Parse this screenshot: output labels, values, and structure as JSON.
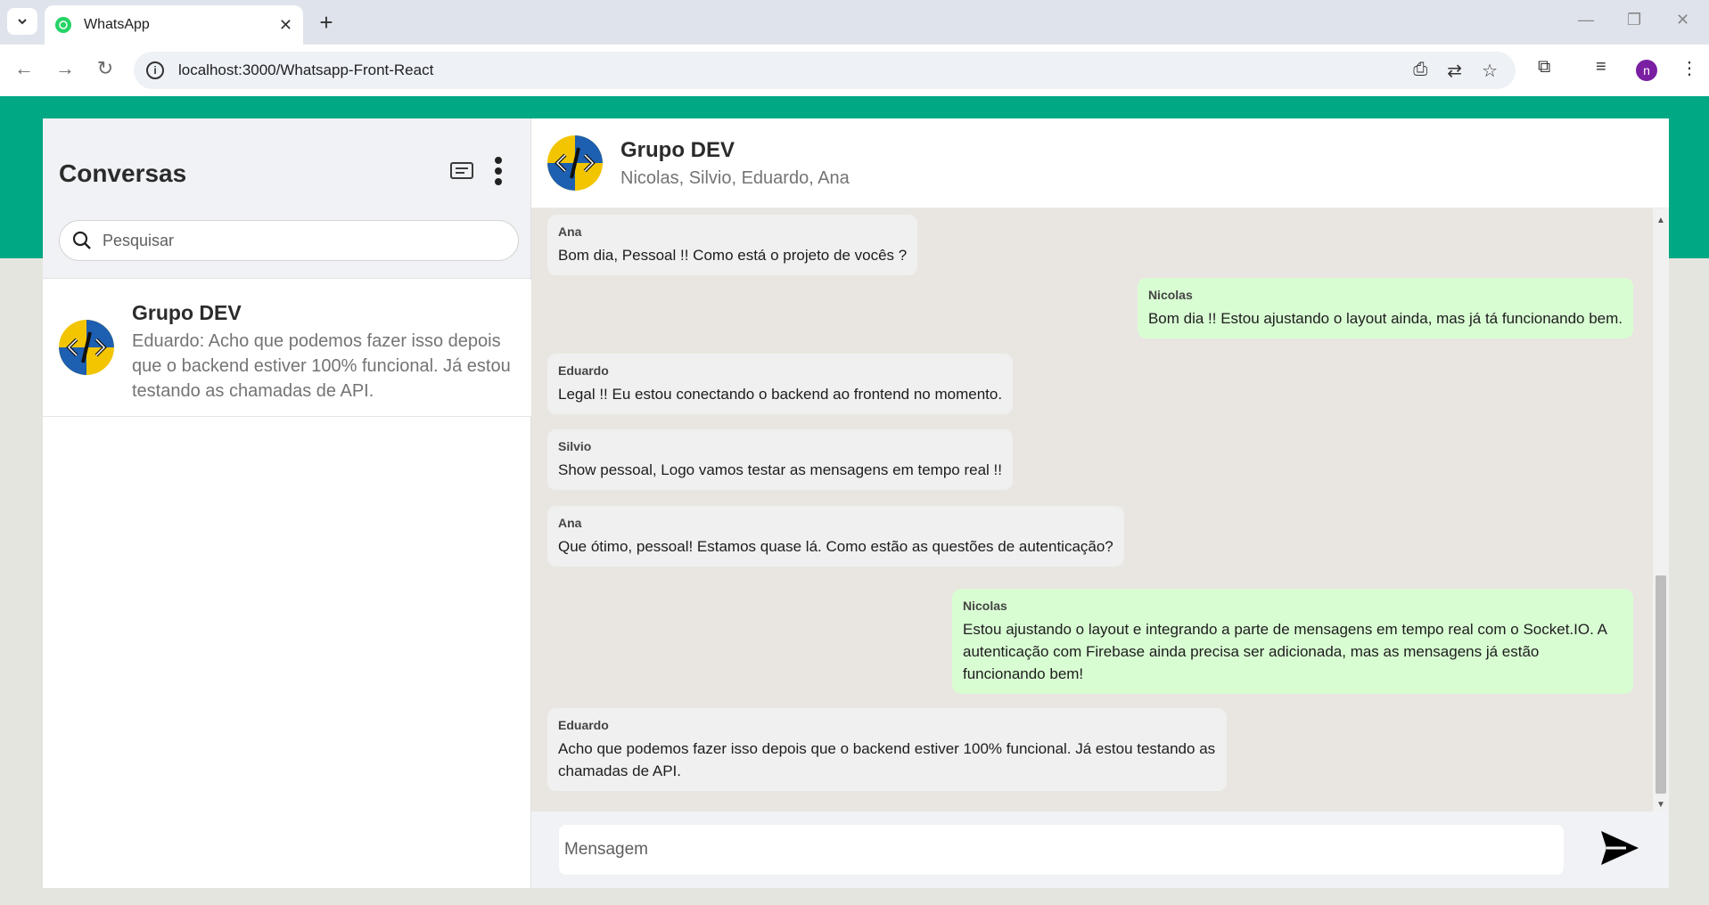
{
  "browser": {
    "tab_title": "WhatsApp",
    "url": "localhost:3000/Whatsapp-Front-React",
    "profile_initial": "n"
  },
  "sidebar": {
    "title": "Conversas",
    "search_placeholder": "Pesquisar",
    "conversations": [
      {
        "name": "Grupo DEV",
        "last_message": "Eduardo: Acho que podemos fazer isso depois que o backend estiver 100% funcional. Já estou testando as chamadas de API."
      }
    ]
  },
  "chat": {
    "title": "Grupo DEV",
    "members": "Nicolas, Silvio, Eduardo, Ana",
    "input_placeholder": "Mensagem",
    "messages": [
      {
        "author": "Ana",
        "text": "Bom dia, Pessoal !! Como está o projeto de vocês ?",
        "direction": "in"
      },
      {
        "author": "Nicolas",
        "text": "Bom dia !! Estou ajustando o layout ainda, mas já tá funcionando bem.",
        "direction": "out"
      },
      {
        "author": "Eduardo",
        "text": "Legal !! Eu estou conectando o backend ao frontend no momento.",
        "direction": "in"
      },
      {
        "author": "Silvio",
        "text": "Show pessoal, Logo vamos testar as mensagens em tempo real !!",
        "direction": "in"
      },
      {
        "author": "Ana",
        "text": "Que ótimo, pessoal! Estamos quase lá. Como estão as questões de autenticação?",
        "direction": "in"
      },
      {
        "author": "Nicolas",
        "text": "Estou ajustando o layout e integrando a parte de mensagens em tempo real com o Socket.IO. A autenticação com Firebase ainda precisa ser adicionada, mas as mensagens já estão funcionando bem!",
        "direction": "out"
      },
      {
        "author": "Eduardo",
        "text": "Acho que podemos fazer isso depois que o backend estiver 100% funcional. Já estou testando as chamadas de API.",
        "direction": "in"
      }
    ]
  },
  "colors": {
    "accent": "#00a884",
    "outgoing_bubble": "#d9fdd3",
    "incoming_bubble": "#f0f0f0"
  }
}
